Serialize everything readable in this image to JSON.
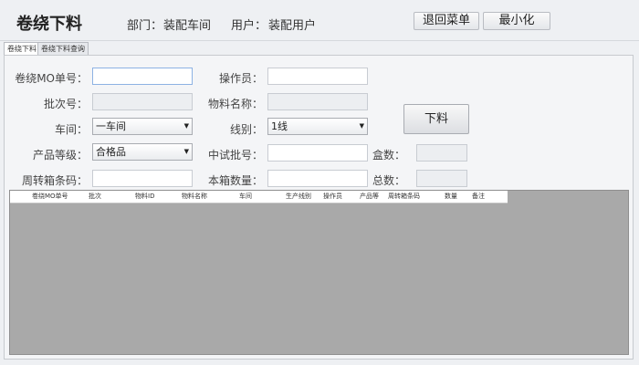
{
  "header": {
    "title": "卷绕下料",
    "dept_label": "部门：",
    "dept_value": "装配车间",
    "user_label": "用户：",
    "user_value": "装配用户",
    "back_button": "退回菜单",
    "minimize_button": "最小化"
  },
  "tabs": [
    {
      "label": "卷绕下料",
      "active": true
    },
    {
      "label": "卷绕下料查询",
      "active": false
    }
  ],
  "form": {
    "mo_label": "卷绕MO单号：",
    "mo_value": "",
    "operator_label": "操作员：",
    "operator_value": "",
    "batch_label": "批次号：",
    "batch_value": "",
    "material_label": "物料名称：",
    "material_value": "",
    "workshop_label": "车间：",
    "workshop_value": "一车间",
    "line_label": "线别：",
    "line_value": "1线",
    "grade_label": "产品等级：",
    "grade_value": "合格品",
    "trial_label": "中试批号：",
    "trial_value": "",
    "box_count_label": "盒数：",
    "box_count_value": "",
    "tote_label": "周转箱条码：",
    "tote_value": "",
    "box_qty_label": "本箱数量：",
    "box_qty_value": "",
    "total_label": "总数：",
    "total_value": "",
    "submit_button": "下料"
  },
  "grid": {
    "columns": [
      "卷绕MO单号",
      "批次",
      "物料ID",
      "物料名称",
      "车间",
      "生产线别",
      "操作员",
      "产品等",
      "周转箱条码",
      "数量",
      "备注"
    ],
    "rows": []
  }
}
